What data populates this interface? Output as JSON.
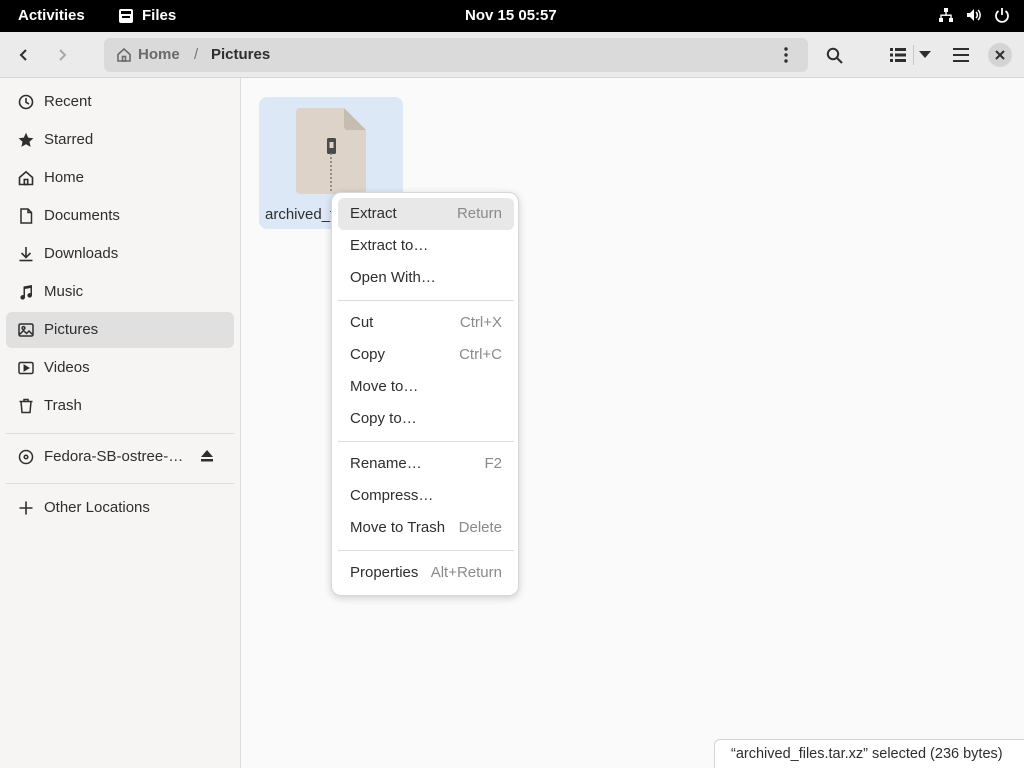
{
  "topbar": {
    "activities": "Activities",
    "app_name": "Files",
    "clock": "Nov 15  05:57"
  },
  "header": {
    "path": {
      "home": "Home",
      "separator": "/",
      "current": "Pictures"
    }
  },
  "sidebar": {
    "items": [
      {
        "label": "Recent",
        "icon": "clock-icon"
      },
      {
        "label": "Starred",
        "icon": "star-icon"
      },
      {
        "label": "Home",
        "icon": "home-icon"
      },
      {
        "label": "Documents",
        "icon": "document-icon"
      },
      {
        "label": "Downloads",
        "icon": "download-icon"
      },
      {
        "label": "Music",
        "icon": "music-icon"
      },
      {
        "label": "Pictures",
        "icon": "picture-icon",
        "active": true
      },
      {
        "label": "Videos",
        "icon": "video-icon"
      },
      {
        "label": "Trash",
        "icon": "trash-icon"
      }
    ],
    "device": {
      "label": "Fedora-SB-ostree-…",
      "icon": "disc-icon"
    },
    "other": {
      "label": "Other Locations",
      "icon": "plus-icon"
    }
  },
  "content": {
    "file": {
      "label": "archived_f",
      "icon": "archive-file-icon"
    }
  },
  "context_menu": {
    "groups": [
      [
        {
          "label": "Extract",
          "shortcut": "Return",
          "highlighted": true
        },
        {
          "label": "Extract to…",
          "shortcut": ""
        },
        {
          "label": "Open With…",
          "shortcut": ""
        }
      ],
      [
        {
          "label": "Cut",
          "shortcut": "Ctrl+X"
        },
        {
          "label": "Copy",
          "shortcut": "Ctrl+C"
        },
        {
          "label": "Move to…",
          "shortcut": ""
        },
        {
          "label": "Copy to…",
          "shortcut": ""
        }
      ],
      [
        {
          "label": "Rename…",
          "shortcut": "F2"
        },
        {
          "label": "Compress…",
          "shortcut": ""
        },
        {
          "label": "Move to Trash",
          "shortcut": "Delete"
        }
      ],
      [
        {
          "label": "Properties",
          "shortcut": "Alt+Return"
        }
      ]
    ]
  },
  "status": "“archived_files.tar.xz” selected  (236 bytes)"
}
